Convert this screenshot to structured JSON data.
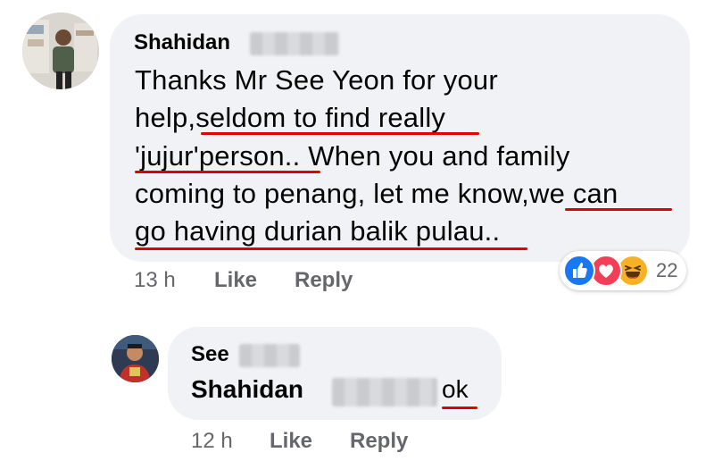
{
  "comment": {
    "author_name": "Shahidan",
    "text_lines": [
      "Thanks Mr See Yeon for your",
      "help,seldom to find really",
      "'jujur'person.. When you and family",
      "coming to penang, let me know,we can",
      "go having durian balik pulau.."
    ],
    "time": "13 h",
    "like_label": "Like",
    "reply_label": "Reply",
    "reaction_count": "22",
    "reaction_icons": [
      "like-icon",
      "love-icon",
      "haha-icon"
    ]
  },
  "reply": {
    "author_name": "See",
    "mention": "Shahidan",
    "text": "ok",
    "time": "12 h",
    "like_label": "Like",
    "reply_label": "Reply"
  },
  "colors": {
    "bubble": "#f0f2f5",
    "underline": "#e00000",
    "meta": "#65676b",
    "like": "#1877f2",
    "love": "#f33e58",
    "haha": "#f7b125"
  }
}
